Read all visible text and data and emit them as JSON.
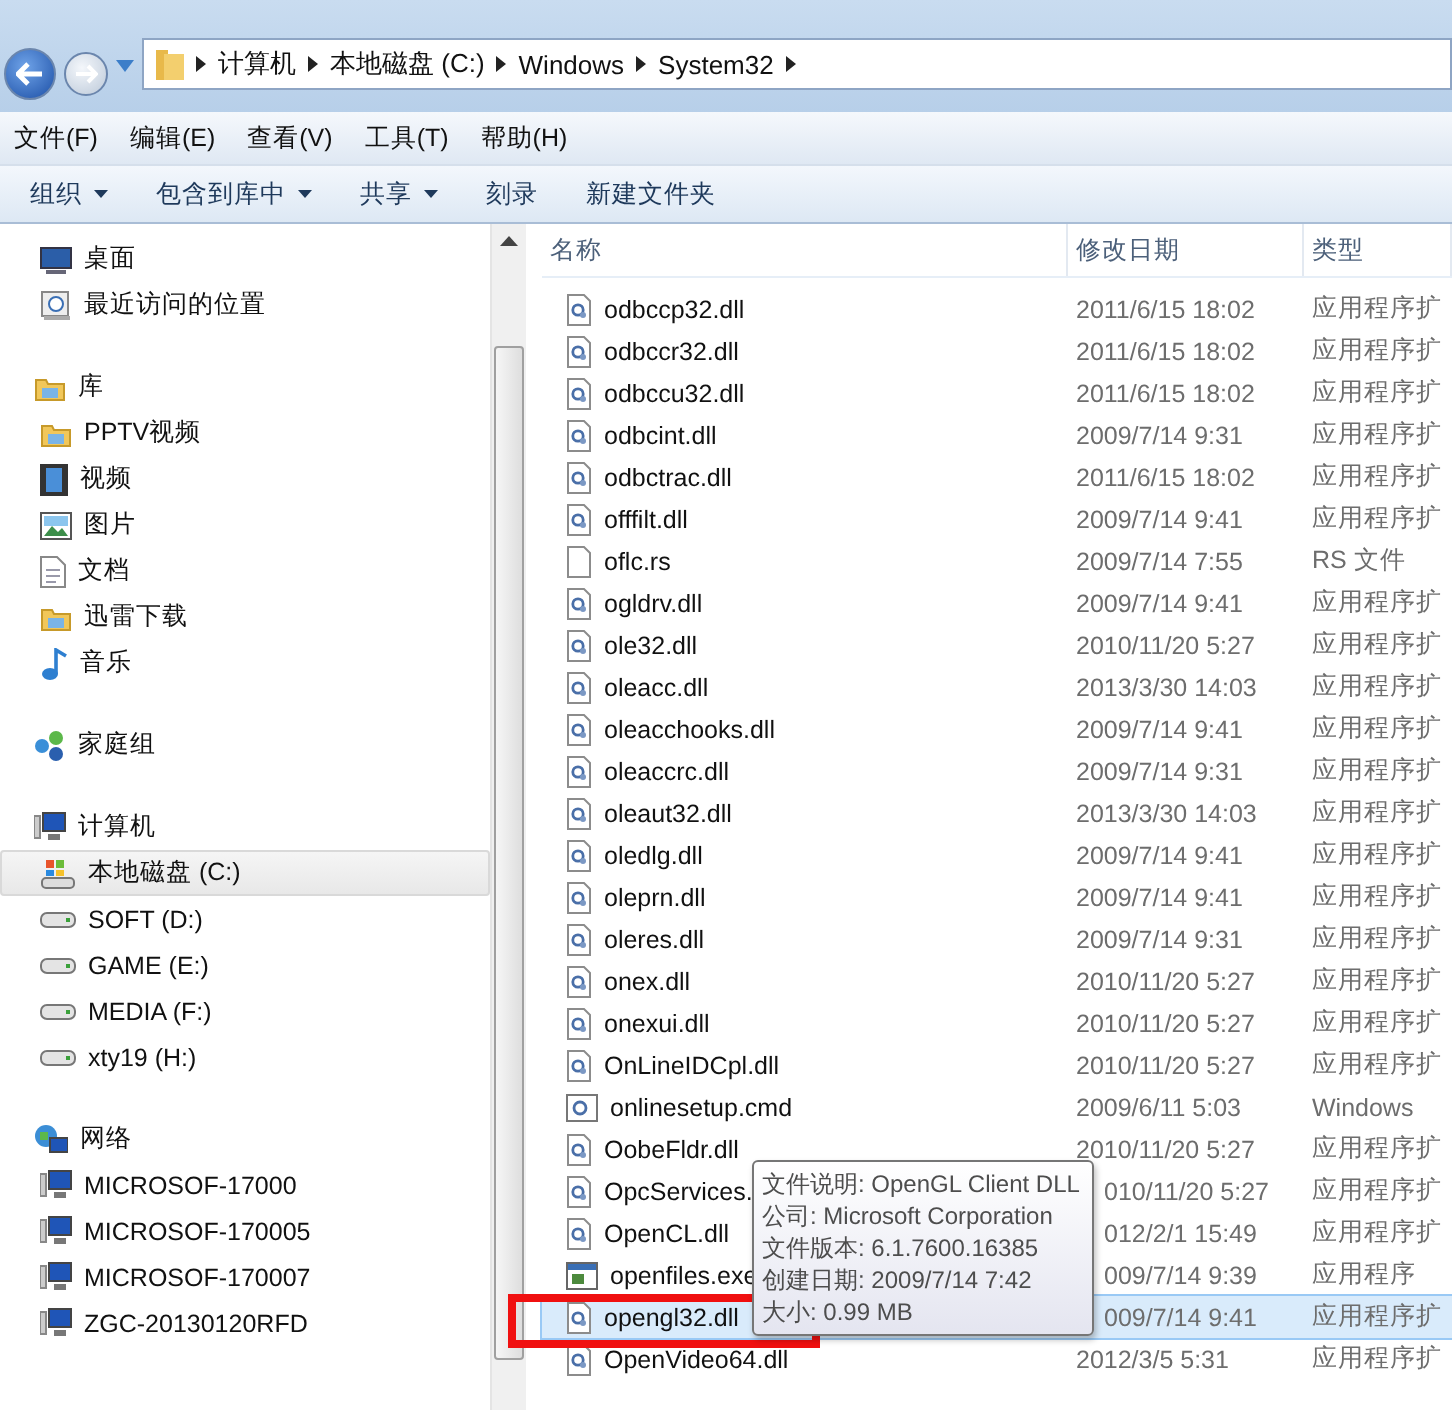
{
  "address_bar": {
    "segments": [
      "计算机",
      "本地磁盘 (C:)",
      "Windows",
      "System32"
    ]
  },
  "menu": [
    "文件(F)",
    "编辑(E)",
    "查看(V)",
    "工具(T)",
    "帮助(H)"
  ],
  "toolbar": [
    {
      "label": "组织",
      "dropdown": true
    },
    {
      "label": "包含到库中",
      "dropdown": true
    },
    {
      "label": "共享",
      "dropdown": true
    },
    {
      "label": "刻录",
      "dropdown": false
    },
    {
      "label": "新建文件夹",
      "dropdown": false
    }
  ],
  "sidebar": [
    {
      "children": [
        {
          "label": "桌面",
          "kind": "desktop",
          "selected": false
        },
        {
          "label": "最近访问的位置",
          "kind": "recent",
          "selected": false
        }
      ]
    },
    {
      "label": "库",
      "kind": "library",
      "children": [
        {
          "label": "PPTV视频",
          "kind": "library",
          "selected": false
        },
        {
          "label": "视频",
          "kind": "video",
          "selected": false
        },
        {
          "label": "图片",
          "kind": "picture",
          "selected": false
        },
        {
          "label": "文档",
          "kind": "document",
          "selected": false
        },
        {
          "label": "迅雷下载",
          "kind": "library",
          "selected": false
        },
        {
          "label": "音乐",
          "kind": "music",
          "selected": false
        }
      ]
    },
    {
      "label": "家庭组",
      "kind": "homegroup"
    },
    {
      "label": "计算机",
      "kind": "computer",
      "children": [
        {
          "label": "本地磁盘 (C:)",
          "kind": "system-drive",
          "selected": true
        },
        {
          "label": "SOFT (D:)",
          "kind": "drive",
          "selected": false
        },
        {
          "label": "GAME (E:)",
          "kind": "drive",
          "selected": false
        },
        {
          "label": "MEDIA (F:)",
          "kind": "drive",
          "selected": false
        },
        {
          "label": "xty19 (H:)",
          "kind": "drive",
          "selected": false
        }
      ]
    },
    {
      "label": "网络",
      "kind": "network",
      "children": [
        {
          "label": "MICROSOF-17000",
          "kind": "computer",
          "selected": false
        },
        {
          "label": "MICROSOF-170005",
          "kind": "computer",
          "selected": false
        },
        {
          "label": "MICROSOF-170007",
          "kind": "computer",
          "selected": false
        },
        {
          "label": "ZGC-20130120RFD",
          "kind": "computer",
          "selected": false
        }
      ]
    }
  ],
  "table": {
    "columns": [
      "名称",
      "修改日期",
      "类型"
    ],
    "rows": [
      {
        "name": "odbccp32.dll",
        "date": "2011/6/15 18:02",
        "type": "应用程序扩",
        "kind": "dll",
        "selected": false
      },
      {
        "name": "odbccr32.dll",
        "date": "2011/6/15 18:02",
        "type": "应用程序扩",
        "kind": "dll",
        "selected": false
      },
      {
        "name": "odbccu32.dll",
        "date": "2011/6/15 18:02",
        "type": "应用程序扩",
        "kind": "dll",
        "selected": false
      },
      {
        "name": "odbcint.dll",
        "date": "2009/7/14 9:31",
        "type": "应用程序扩",
        "kind": "dll",
        "selected": false
      },
      {
        "name": "odbctrac.dll",
        "date": "2011/6/15 18:02",
        "type": "应用程序扩",
        "kind": "dll",
        "selected": false
      },
      {
        "name": "offfilt.dll",
        "date": "2009/7/14 9:41",
        "type": "应用程序扩",
        "kind": "dll",
        "selected": false
      },
      {
        "name": "oflc.rs",
        "date": "2009/7/14 7:55",
        "type": "RS 文件",
        "kind": "file",
        "selected": false
      },
      {
        "name": "ogldrv.dll",
        "date": "2009/7/14 9:41",
        "type": "应用程序扩",
        "kind": "dll",
        "selected": false
      },
      {
        "name": "ole32.dll",
        "date": "2010/11/20 5:27",
        "type": "应用程序扩",
        "kind": "dll",
        "selected": false
      },
      {
        "name": "oleacc.dll",
        "date": "2013/3/30 14:03",
        "type": "应用程序扩",
        "kind": "dll",
        "selected": false
      },
      {
        "name": "oleacchooks.dll",
        "date": "2009/7/14 9:41",
        "type": "应用程序扩",
        "kind": "dll",
        "selected": false
      },
      {
        "name": "oleaccrc.dll",
        "date": "2009/7/14 9:31",
        "type": "应用程序扩",
        "kind": "dll",
        "selected": false
      },
      {
        "name": "oleaut32.dll",
        "date": "2013/3/30 14:03",
        "type": "应用程序扩",
        "kind": "dll",
        "selected": false
      },
      {
        "name": "oledlg.dll",
        "date": "2009/7/14 9:41",
        "type": "应用程序扩",
        "kind": "dll",
        "selected": false
      },
      {
        "name": "oleprn.dll",
        "date": "2009/7/14 9:41",
        "type": "应用程序扩",
        "kind": "dll",
        "selected": false
      },
      {
        "name": "oleres.dll",
        "date": "2009/7/14 9:31",
        "type": "应用程序扩",
        "kind": "dll",
        "selected": false
      },
      {
        "name": "onex.dll",
        "date": "2010/11/20 5:27",
        "type": "应用程序扩",
        "kind": "dll",
        "selected": false
      },
      {
        "name": "onexui.dll",
        "date": "2010/11/20 5:27",
        "type": "应用程序扩",
        "kind": "dll",
        "selected": false
      },
      {
        "name": "OnLineIDCpl.dll",
        "date": "2010/11/20 5:27",
        "type": "应用程序扩",
        "kind": "dll",
        "selected": false
      },
      {
        "name": "onlinesetup.cmd",
        "date": "2009/6/11 5:03",
        "type": "Windows",
        "kind": "cmd",
        "selected": false
      },
      {
        "name": "OobeFldr.dll",
        "date": "2010/11/20 5:27",
        "type": "应用程序扩",
        "kind": "dll",
        "selected": false
      },
      {
        "name": "OpcServices.",
        "date": "010/11/20 5:27",
        "type": "应用程序扩",
        "kind": "dll",
        "selected": false
      },
      {
        "name": "OpenCL.dll",
        "date": "012/2/1 15:49",
        "type": "应用程序扩",
        "kind": "dll",
        "selected": false
      },
      {
        "name": "openfiles.exe",
        "date": "009/7/14 9:39",
        "type": "应用程序",
        "kind": "exe",
        "selected": false
      },
      {
        "name": "opengl32.dll",
        "date": "009/7/14 9:41",
        "type": "应用程序扩",
        "kind": "dll",
        "selected": true
      },
      {
        "name": "OpenVideo64.dll",
        "date": "2012/3/5 5:31",
        "type": "应用程序扩",
        "kind": "dll",
        "selected": false
      }
    ]
  },
  "tooltip": {
    "lines": [
      "文件说明: OpenGL Client DLL",
      "公司: Microsoft Corporation",
      "文件版本: 6.1.7600.16385",
      "创建日期: 2009/7/14 7:42",
      "大小: 0.99 MB"
    ]
  }
}
